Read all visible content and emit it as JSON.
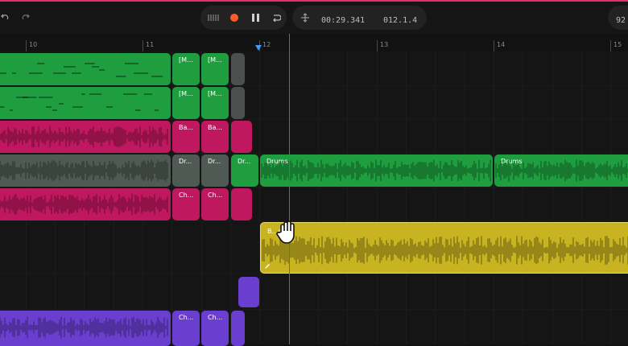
{
  "colors": {
    "accent": "#e4306a",
    "green": "#1f9e3f",
    "pink": "#c0185e",
    "grey": "#505a55",
    "yellow": "#c8b320",
    "purple": "#6a3fd0",
    "record": "#ff5a2a"
  },
  "transport": {
    "time": "00:29.341",
    "position": "012.1.4",
    "tempo": "92"
  },
  "ruler": {
    "bars": [
      "10",
      "11",
      "12",
      "13",
      "14",
      "15"
    ]
  },
  "clips": {
    "midi_a": "[M...",
    "midi_b": "[M...",
    "bass_a": "Ba...",
    "bass_b": "Ba...",
    "drums_a": "Dr...",
    "drums_b": "Dr...",
    "drums_c": "Dr...",
    "drums_main": "Drums",
    "drums_next": "Drums",
    "chords_a": "Ch...",
    "chords_b": "Ch...",
    "yellow_label": "B...a",
    "chords_c": "Ch...",
    "chords_d": "Ch..."
  },
  "icons": {
    "undo": "undo-icon",
    "redo": "redo-icon",
    "metronome": "metronome-icon",
    "record": "record-icon",
    "pause": "pause-icon",
    "loop": "loop-icon",
    "snap": "snap-icon",
    "grab": "grab-hand-icon"
  }
}
